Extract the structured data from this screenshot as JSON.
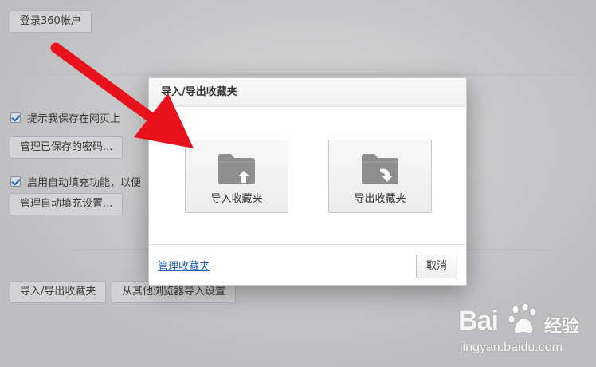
{
  "background": {
    "login_button": "登录360帐户",
    "checkbox_save_password": {
      "label": "提示我保存在网页上",
      "checked": true
    },
    "manage_passwords_button": "管理已保存的密码...",
    "checkbox_autofill": {
      "label": "启用自动填充功能，以便",
      "checked": true
    },
    "manage_autofill_button": "管理自动填充设置...",
    "import_export_button": "导入/导出收藏夹",
    "import_from_other_button": "从其他浏览器导入设置"
  },
  "dialog": {
    "title": "导入/导出收藏夹",
    "import_button": {
      "label": "导入收藏夹",
      "icon": "folder-import-icon"
    },
    "export_button": {
      "label": "导出收藏夹",
      "icon": "folder-export-icon"
    },
    "manage_link": "管理收藏夹",
    "cancel_button": "取消"
  },
  "annotation": {
    "color": "#e8121c"
  },
  "watermark": {
    "brand": "Bai",
    "brand_suffix": "经验",
    "url": "jingyan.baidu.com"
  }
}
